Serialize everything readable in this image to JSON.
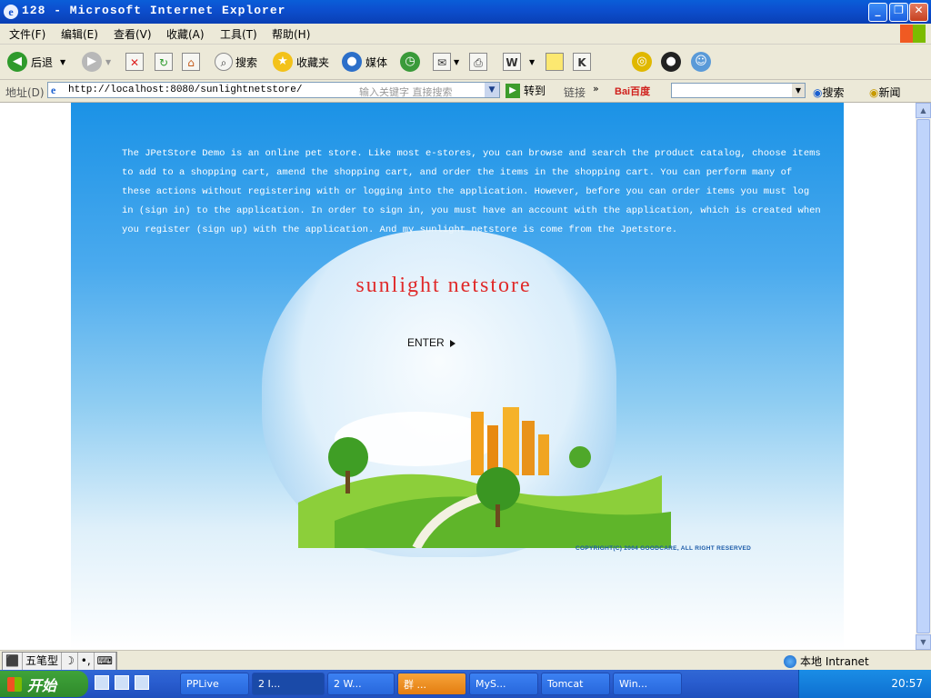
{
  "window": {
    "title": "128 - Microsoft Internet Explorer",
    "icon": "ie-icon",
    "buttons": {
      "minimize": "_",
      "maximize": "❐",
      "close": "✕"
    }
  },
  "menu": [
    "文件(F)",
    "编辑(E)",
    "查看(V)",
    "收藏(A)",
    "工具(T)",
    "帮助(H)"
  ],
  "toolbar": {
    "back": "后退",
    "search": "搜索",
    "favorites": "收藏夹",
    "media": "媒体"
  },
  "address": {
    "label": "地址(D)",
    "url": "http://localhost:8080/sunlightnetstore/",
    "search_hint": "输入关键字 直接搜索",
    "go": "转到",
    "links": "链接",
    "baidu_logo": "Bai百度",
    "baidu_search": "搜索",
    "news": "新闻"
  },
  "page": {
    "intro": "The JPetStore Demo is an online pet store. Like most e-stores, you can browse and search the product catalog, choose items to add to a shopping cart, amend the shopping cart, and order the items in the shopping cart. You can perform many of these actions without registering with or logging into the application. However, before you can order items you must log in (sign in) to the application. In order to sign in, you must have an account with the application, which is created when you register (sign up) with the application. And my sunlight netstore is come from the Jpetstore.",
    "brand": "sunlight netstore",
    "enter": "ENTER",
    "copyright": "COPYRIGHT(C) 2004 GOODCARE, ALL RIGHT RESERVED"
  },
  "status": {
    "ime": [
      "五笔型"
    ],
    "zone": "本地 Intranet"
  },
  "taskbar": {
    "start": "开始",
    "tasks": [
      {
        "label": "PPLive",
        "active": false
      },
      {
        "label": "2 I...",
        "active": true
      },
      {
        "label": "2 W...",
        "active": false
      },
      {
        "label": "群 ...",
        "active": false
      },
      {
        "label": "MyS...",
        "active": false
      },
      {
        "label": "Tomcat",
        "active": false
      },
      {
        "label": "Win...",
        "active": false
      }
    ],
    "clock": "20:57"
  }
}
